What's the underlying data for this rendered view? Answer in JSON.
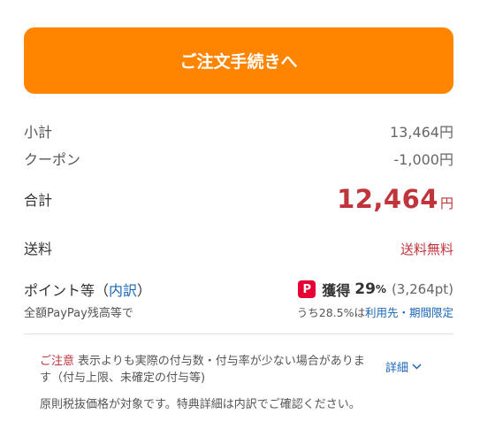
{
  "checkout": {
    "button_label": "ご注文手続きへ"
  },
  "summary": {
    "subtotal_label": "小計",
    "subtotal_value": "13,464円",
    "coupon_label": "クーポン",
    "coupon_value": "-1,000円",
    "total_label": "合計",
    "total_amount": "12,464",
    "total_unit": "円",
    "shipping_label": "送料",
    "shipping_value": "送料無料"
  },
  "points": {
    "title_prefix": "ポイント等（",
    "breakdown_link": "内訳",
    "title_suffix": "）",
    "subtitle": "全額PayPay残高等で",
    "icon": "paypay-icon",
    "icon_glyph": "P",
    "earn_label": "獲得",
    "earn_percent": "29",
    "percent_sign": "%",
    "earn_points": "(3,264pt)",
    "rate_prefix": "うち28.5%は",
    "rate_link": "利用先・期間限定"
  },
  "notice": {
    "caution_label": "ご注意",
    "text": "表示よりも実際の付与数・付与率が少ない場合があります（付与上限、未確定の付与等)",
    "detail_link": "詳細",
    "footnote": "原則税抜価格が対象です。特典詳細は内訳でご確認ください。"
  },
  "colors": {
    "accent": "#ff8400",
    "price_red": "#c0353b",
    "link_blue": "#1a66b8",
    "paypay_red": "#e60033"
  }
}
